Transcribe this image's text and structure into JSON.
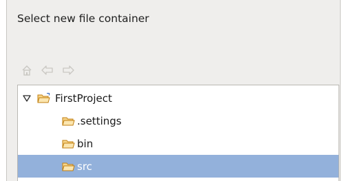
{
  "dialog": {
    "prompt": "Select new file container"
  },
  "toolbar": {
    "buttons": [
      {
        "name": "home",
        "icon": "home-icon",
        "enabled": false
      },
      {
        "name": "back",
        "icon": "back-arrow-icon",
        "enabled": false
      },
      {
        "name": "forward",
        "icon": "forward-arrow-icon",
        "enabled": false
      }
    ]
  },
  "tree": {
    "root": {
      "label": "FirstProject",
      "expanded": true,
      "icon": "project-folder-icon"
    },
    "children": [
      {
        "label": ".settings",
        "icon": "folder-icon",
        "selected": false
      },
      {
        "label": "bin",
        "icon": "folder-icon",
        "selected": false
      },
      {
        "label": "src",
        "icon": "folder-icon",
        "selected": true
      }
    ]
  },
  "colors": {
    "dialog_bg": "#efeeec",
    "selection": "#93b1db",
    "folder": "#e8a21a"
  }
}
